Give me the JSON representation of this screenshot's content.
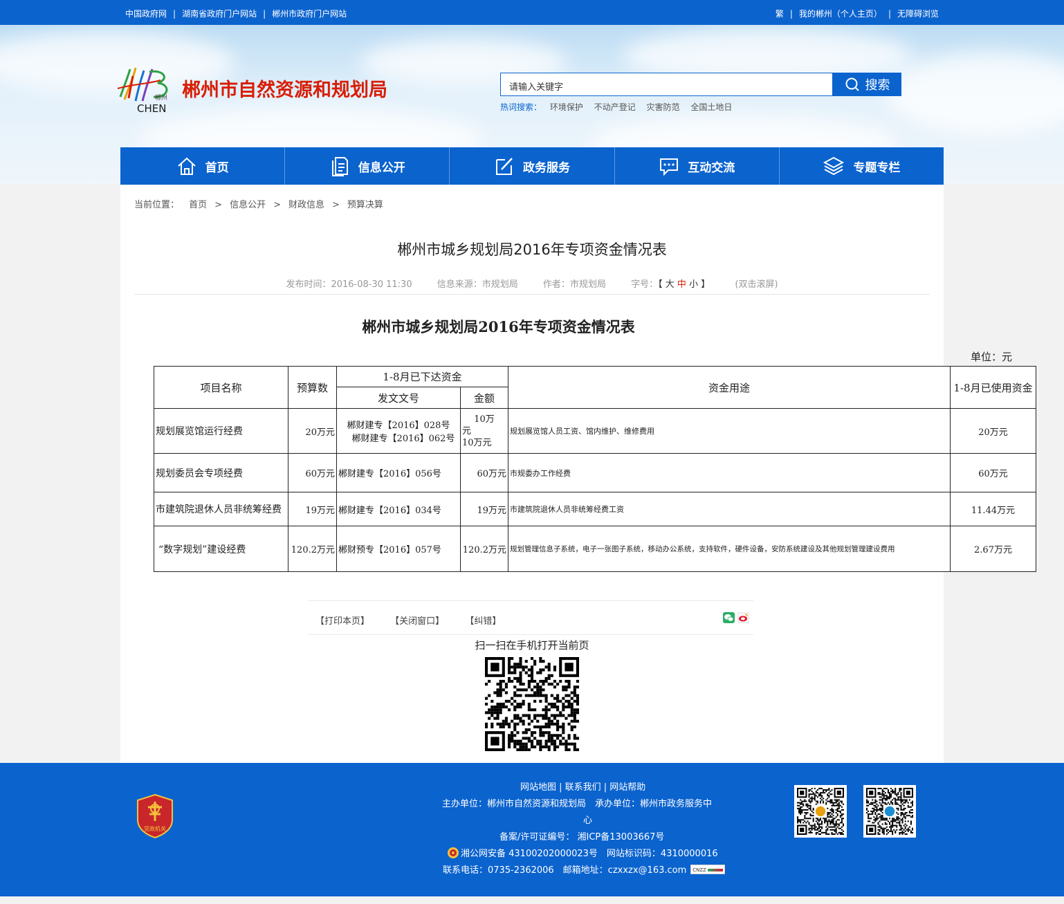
{
  "topbar": {
    "links": [
      "中国政府网",
      "湖南省政府门户网站",
      "郴州市政府门户网站"
    ],
    "right": [
      "繁",
      "我的郴州（个人主页）",
      "无障碍浏览"
    ]
  },
  "header": {
    "logo_text": "CHEN",
    "logo_cn": "郴州",
    "site_title": "郴州市自然资源和规划局",
    "search_placeholder": "请输入关键字",
    "search_button": "搜索",
    "hot_label": "热词搜索：",
    "hot_words": [
      "环境保护",
      "不动产登记",
      "灾害防范",
      "全国土地日"
    ]
  },
  "nav": [
    {
      "label": "首页",
      "icon": "home-icon"
    },
    {
      "label": "信息公开",
      "icon": "document-icon"
    },
    {
      "label": "政务服务",
      "icon": "edit-icon"
    },
    {
      "label": "互动交流",
      "icon": "chat-icon"
    },
    {
      "label": "专题专栏",
      "icon": "layers-icon"
    }
  ],
  "breadcrumb": {
    "label": "当前位置：",
    "items": [
      "首页",
      "信息公开",
      "财政信息",
      "预算决算"
    ],
    "sep": ">"
  },
  "article": {
    "title": "郴州市城乡规划局2016年专项资金情况表",
    "publish_label": "发布时间：",
    "publish_time": "2016-08-30 11:30",
    "source_label": "信息来源：",
    "source": "市规划局",
    "author_label": "作者：",
    "author": "市规划局",
    "font_label": "字号：",
    "font_open": "【",
    "font_large": "大",
    "font_mid": "中",
    "font_small": "小",
    "font_close": "】",
    "dbl_scroll": "(双击滚屏)"
  },
  "document": {
    "title": "郴州市城乡规划局2016年专项资金情况表",
    "unit": "单位：元",
    "headers": {
      "name": "项目名称",
      "budget": "预算数",
      "issued": "1-8月已下达资金",
      "doc_no": "发文文号",
      "amount": "金额",
      "usage": "资金用途",
      "used": "1-8月已使用资金"
    },
    "rows": [
      {
        "name": "规划展览馆运行经费",
        "budget": "20万元",
        "doc_no_1": "郴财建专【2016】028号",
        "doc_no_2": "郴财建专【2016】062号",
        "amount_1": "10万",
        "amount_2": "元",
        "amount_3": "10万元",
        "usage": "规划展览馆人员工资、馆内维护、维修费用",
        "used": "20万元"
      },
      {
        "name": "规划委员会专项经费",
        "budget": "60万元",
        "doc_no": "郴财建专【2016】056号",
        "amount": "60万元",
        "usage": "市规委办工作经费",
        "used": "60万元"
      },
      {
        "name": "市建筑院退休人员非统筹经费",
        "budget": "19万元",
        "doc_no": "郴财建专【2016】034号",
        "amount": "19万元",
        "usage": "市建筑院退休人员非统筹经费工资",
        "used": "11.44万元"
      },
      {
        "name": "“数字规划”建设经费",
        "budget": "120.2万元",
        "doc_no": "郴财预专【2016】057号",
        "amount": "120.2万元",
        "usage": "规划管理信息子系统，电子一张图子系统，移动办公系统，支持软件，硬件设备，安防系统建设及其他规划管理建设费用",
        "used": "2.67万元"
      }
    ]
  },
  "share": {
    "print": "【打印本页】",
    "close": "【关闭窗口】",
    "error": "【纠错】",
    "qr_text": "扫一扫在手机打开当前页"
  },
  "footer": {
    "links": "网站地图 | 联系我们 | 网站帮助",
    "host": "主办单位：郴州市自然资源和规划局　承办单位：郴州市政务服务中",
    "host_cont": "心",
    "icp": "备案/许可证编号：  湘ICP备13003667号",
    "police": "湘公网安备 43100202000023号　网站标识码：4310000016",
    "contact": "联系电话：0735-2362006　邮箱地址：czxxzx@163.com",
    "badge_text": "党政机关",
    "cnzz": "CNZZ"
  },
  "colors": {
    "brand_blue": "#0b63ce",
    "title_red": "#d81e06"
  }
}
